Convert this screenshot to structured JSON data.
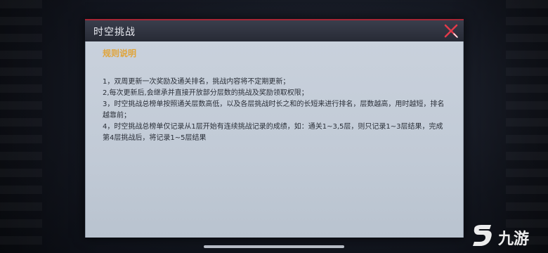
{
  "dialog": {
    "title": "时空挑战",
    "close_icon": "close-x-icon",
    "accent_color": "#a52635"
  },
  "rules": {
    "section_title": "规则说明",
    "section_title_color": "#e0a43a",
    "items": [
      "1，双周更新一次奖励及通关排名，挑战内容将不定期更新；",
      "2,每次更新后,会继承并直接开放部分层数的挑战及奖励领取权限；",
      "3，时空挑战总榜单按照通关层数高低，以及各层挑战时长之和的长短来进行排名，层数越高，用时越短，排名越靠前；",
      "4，时空挑战总榜单仅记录从1层开始有连续挑战记录的成绩，如：通关1~3,5层，则只记录1~3层结果，完成第4层挑战后，将记录1~5层结果"
    ]
  },
  "watermark": {
    "text": "九游",
    "logo_icon": "jiuyou-logo-icon"
  }
}
